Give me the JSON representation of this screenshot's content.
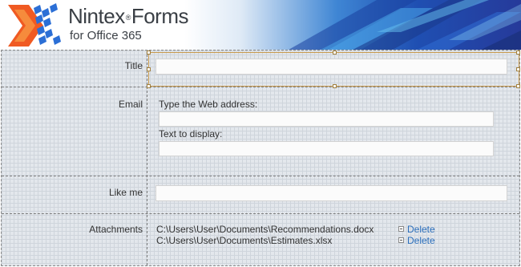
{
  "banner": {
    "product_name": "Nintex",
    "registered_mark": "®",
    "product_word": "Forms",
    "subtitle": "for Office 365"
  },
  "form": {
    "title": {
      "label": "Title",
      "value": ""
    },
    "email": {
      "label": "Email",
      "web_address_label": "Type the Web address:",
      "web_address_value": "",
      "display_text_label": "Text to display:",
      "display_text_value": ""
    },
    "like_me": {
      "label": "Like me",
      "value": ""
    },
    "attachments": {
      "label": "Attachments",
      "files": [
        {
          "path": "C:\\Users\\User\\Documents\\Recommendations.docx",
          "action": "Delete"
        },
        {
          "path": "C:\\Users\\User\\Documents\\Estimates.xlsx",
          "action": "Delete"
        }
      ]
    }
  },
  "colors": {
    "banner_blue": "#1f4fb2",
    "logo_orange": "#f05a22",
    "logo_blue": "#2b6fd6",
    "link": "#2a6ebb",
    "selection_border": "#c89a4e"
  }
}
